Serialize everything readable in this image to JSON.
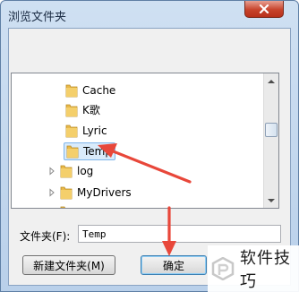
{
  "dialog": {
    "title": "浏览文件夹",
    "close_icon": "close-icon"
  },
  "tree": {
    "items": [
      {
        "label": "Cache",
        "level": 2,
        "expandable": false,
        "selected": false
      },
      {
        "label": "K歌",
        "level": 2,
        "expandable": false,
        "selected": false
      },
      {
        "label": "Lyric",
        "level": 2,
        "expandable": false,
        "selected": false
      },
      {
        "label": "Temp",
        "level": 2,
        "expandable": false,
        "selected": true
      },
      {
        "label": "log",
        "level": 1,
        "expandable": true,
        "selected": false
      },
      {
        "label": "MyDrivers",
        "level": 1,
        "expandable": true,
        "selected": false
      }
    ]
  },
  "folder": {
    "label": "文件夹(F):",
    "value": "Temp"
  },
  "buttons": {
    "new_folder": "新建文件夹(M)",
    "ok": "确定"
  },
  "watermark": {
    "text": "软件技巧"
  },
  "colors": {
    "arrow": "#e8473a",
    "folder": "#e9b94a",
    "selection": "#d9ebfb"
  }
}
